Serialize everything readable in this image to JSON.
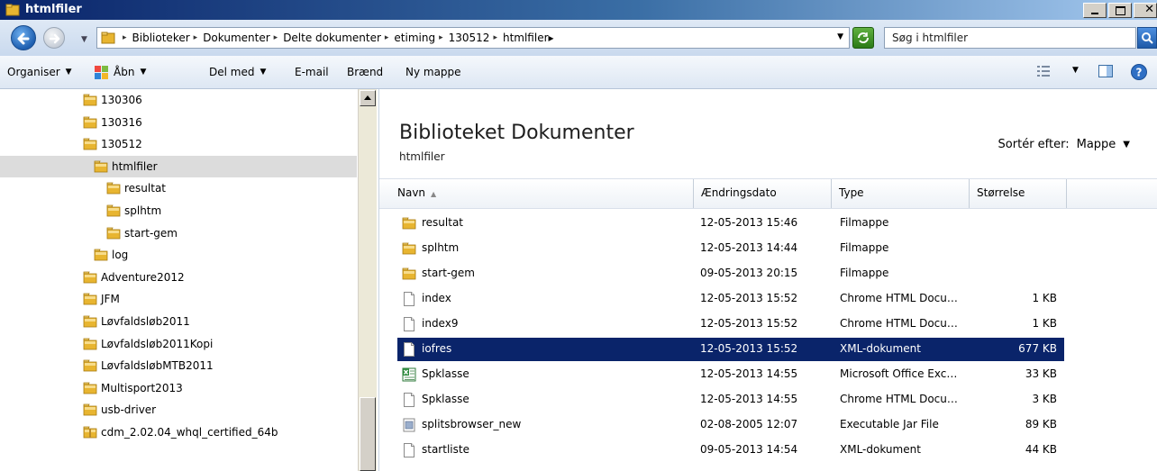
{
  "window": {
    "title": "htmlfiler"
  },
  "address": {
    "crumbs": [
      "Biblioteker",
      "Dokumenter",
      "Delte dokumenter",
      "etiming",
      "130512",
      "htmlfiler"
    ],
    "search_placeholder": "Søg i htmlfiler"
  },
  "toolbar": {
    "organise": "Organiser",
    "open": "Åbn",
    "share": "Del med",
    "email": "E-mail",
    "burn": "Brænd",
    "new_folder": "Ny mappe"
  },
  "tree": {
    "items": [
      {
        "label": "130306",
        "icon": "folder"
      },
      {
        "label": "130316",
        "icon": "folder"
      },
      {
        "label": "130512",
        "icon": "folder"
      },
      {
        "label": "htmlfiler",
        "icon": "folder-open"
      },
      {
        "label": "resultat",
        "icon": "folder"
      },
      {
        "label": "splhtm",
        "icon": "folder"
      },
      {
        "label": "start-gem",
        "icon": "folder"
      },
      {
        "label": "log",
        "icon": "folder"
      },
      {
        "label": "Adventure2012",
        "icon": "folder"
      },
      {
        "label": "JFM",
        "icon": "folder"
      },
      {
        "label": "Løvfaldsløb2011",
        "icon": "folder"
      },
      {
        "label": "Løvfaldsløb2011Kopi",
        "icon": "folder"
      },
      {
        "label": "LøvfaldsløbMTB2011",
        "icon": "folder"
      },
      {
        "label": "Multisport2013",
        "icon": "folder"
      },
      {
        "label": "usb-driver",
        "icon": "folder"
      },
      {
        "label": "cdm_2.02.04_whql_certified_64b",
        "icon": "folder-zip"
      }
    ]
  },
  "library": {
    "title": "Biblioteket Dokumenter",
    "subtitle": "htmlfiler",
    "sort_label": "Sortér efter:",
    "sort_value": "Mappe"
  },
  "columns": {
    "name": "Navn",
    "date": "Ændringsdato",
    "type": "Type",
    "size": "Størrelse"
  },
  "files": [
    {
      "name": "resultat",
      "date": "12-05-2013 15:46",
      "type": "Filmappe",
      "size": "",
      "icon": "folder"
    },
    {
      "name": "splhtm",
      "date": "12-05-2013 14:44",
      "type": "Filmappe",
      "size": "",
      "icon": "folder"
    },
    {
      "name": "start-gem",
      "date": "09-05-2013 20:15",
      "type": "Filmappe",
      "size": "",
      "icon": "folder"
    },
    {
      "name": "index",
      "date": "12-05-2013 15:52",
      "type": "Chrome HTML Docu…",
      "size": "1 KB",
      "icon": "document"
    },
    {
      "name": "index9",
      "date": "12-05-2013 15:52",
      "type": "Chrome HTML Docu…",
      "size": "1 KB",
      "icon": "document"
    },
    {
      "name": "iofres",
      "date": "12-05-2013 15:52",
      "type": "XML-dokument",
      "size": "677 KB",
      "icon": "document"
    },
    {
      "name": "Spklasse",
      "date": "12-05-2013 14:55",
      "type": "Microsoft Office Exc…",
      "size": "33 KB",
      "icon": "excel"
    },
    {
      "name": "Spklasse",
      "date": "12-05-2013 14:55",
      "type": "Chrome HTML Docu…",
      "size": "3 KB",
      "icon": "document"
    },
    {
      "name": "splitsbrowser_new",
      "date": "02-08-2005 12:07",
      "type": "Executable Jar File",
      "size": "89 KB",
      "icon": "jar"
    },
    {
      "name": "startliste",
      "date": "09-05-2013 14:54",
      "type": "XML-dokument",
      "size": "44 KB",
      "icon": "document"
    }
  ],
  "colors": {
    "selection": "#0a246a",
    "tree_selection": "#dcdcdc",
    "folder": "#e8b530"
  }
}
